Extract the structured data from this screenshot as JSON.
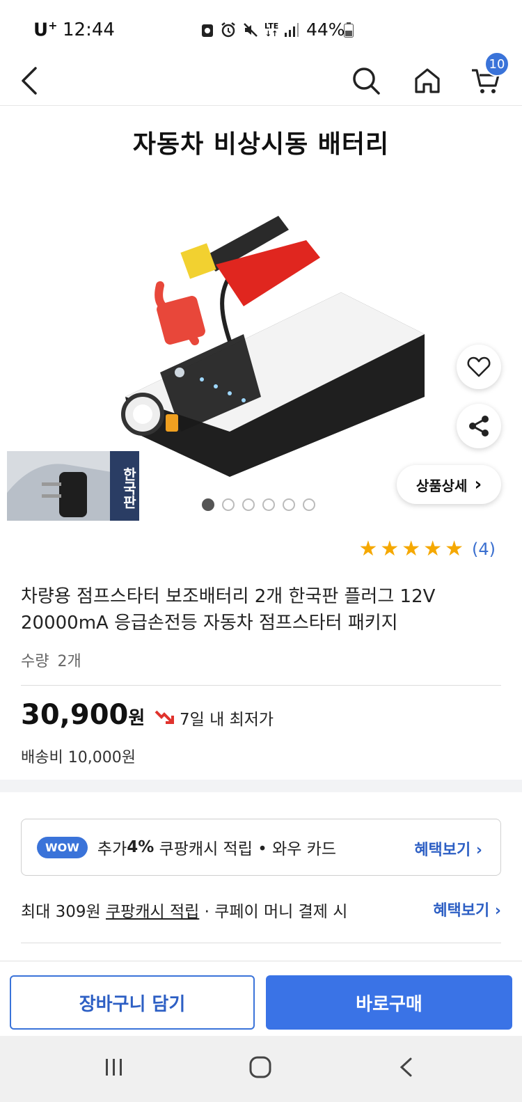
{
  "status_bar": {
    "carrier": "U",
    "carrier_sup": "+",
    "time": "12:44",
    "lte_top": "LTE",
    "lte_bottom": "↓↑",
    "battery_percent": "44%"
  },
  "header": {
    "cart_badge": "10"
  },
  "hero": {
    "title": "자동차 비상시동 배터리",
    "thumb_label": "한국판"
  },
  "floating": {
    "detail_label": "상품상세",
    "detail_chevron": "›"
  },
  "gallery": {
    "dot_count": 6,
    "active_index": 0
  },
  "rating": {
    "stars": 5,
    "count": "(4)"
  },
  "product": {
    "name": "차량용 점프스타터 보조배터리 2개 한국판 플러그 12V 20000mA 응급손전등 자동차 점프스타터 패키지",
    "quantity_label": "수량",
    "quantity_value": "2개",
    "price": "30,900",
    "price_unit": "원",
    "lowest_label": "7일 내 최저가",
    "shipping": "배송비 10,000원"
  },
  "wow": {
    "badge": "WOW",
    "text_pre": "추가 ",
    "text_bold": "4%",
    "text_post": " 쿠팡캐시 적립 • 와우 카드",
    "link": "혜택보기 ›"
  },
  "coupay": {
    "pre": "최대 309원 ",
    "underlined": "쿠팡캐시 적립",
    "post": " · 쿠페이 머니 결제 시",
    "link": "혜택보기 ›"
  },
  "actions": {
    "add_to_cart": "장바구니 담기",
    "buy_now": "바로구매"
  },
  "colors": {
    "accent": "#3a73d9",
    "link": "#2d5fc4",
    "star": "#f5a800",
    "price_arrow": "#e0332d"
  }
}
